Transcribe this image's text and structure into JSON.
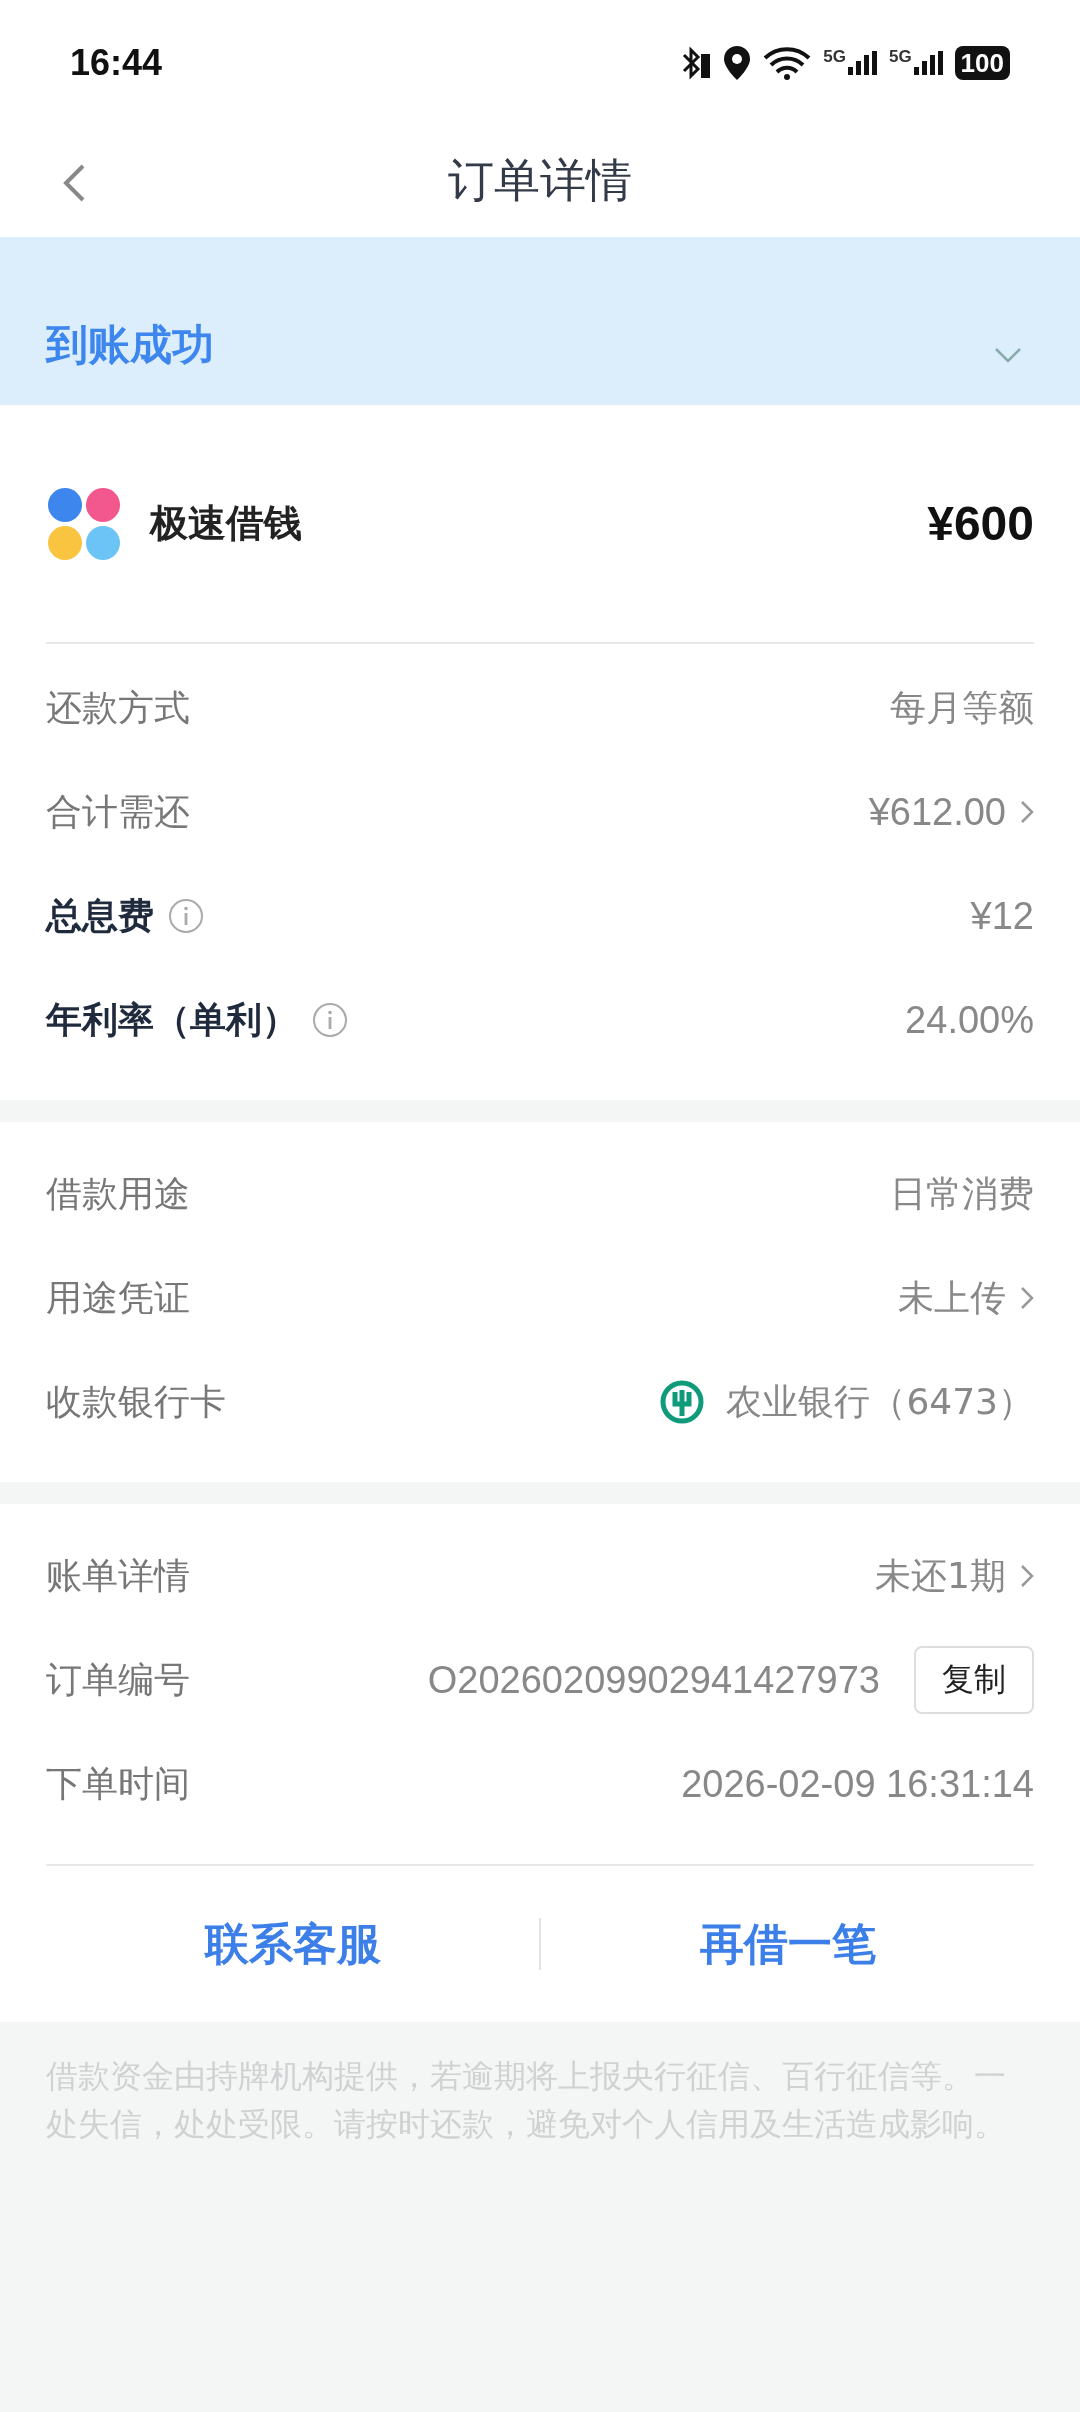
{
  "status_bar": {
    "time": "16:44",
    "network": [
      "5G",
      "5G"
    ],
    "battery": "100"
  },
  "nav": {
    "title": "订单详情"
  },
  "status_banner": {
    "text": "到账成功",
    "expanded": false
  },
  "product": {
    "name": "极速借钱",
    "amount": "¥600"
  },
  "sections": [
    {
      "rows": [
        {
          "kind": "text",
          "label": "还款方式",
          "value": "每月等额",
          "strong": false
        },
        {
          "kind": "link",
          "label": "合计需还",
          "value": "¥612.00",
          "strong": false
        },
        {
          "kind": "text",
          "label": "总息费",
          "value": "¥12",
          "strong": true
        },
        {
          "kind": "text",
          "label": "年利率（单利）",
          "value": "24.00%",
          "strong": true
        }
      ]
    },
    {
      "rows": [
        {
          "kind": "text",
          "label": "借款用途",
          "value": "日常消费",
          "strong": false
        },
        {
          "kind": "link",
          "label": "用途凭证",
          "value": "未上传",
          "strong": false
        },
        {
          "kind": "bank",
          "label": "收款银行卡",
          "value": "农业银行（6473）",
          "strong": false
        }
      ]
    },
    {
      "rows": [
        {
          "kind": "link",
          "label": "账单详情",
          "value": "未还1期",
          "strong": false
        },
        {
          "kind": "copy",
          "label": "订单编号",
          "value": "O20260209902941427973",
          "action": "复制",
          "strong": false
        },
        {
          "kind": "text",
          "label": "下单时间",
          "value": "2026-02-09 16:31:14",
          "strong": false
        }
      ]
    }
  ],
  "actions": [
    "联系客服",
    "再借一笔"
  ],
  "disclaimer": "借款资金由持牌机构提供，若逾期将上报央行征信、百行征信等。一处失信，处处受限。请按时还款，避免对个人信用及生活造成影响。"
}
